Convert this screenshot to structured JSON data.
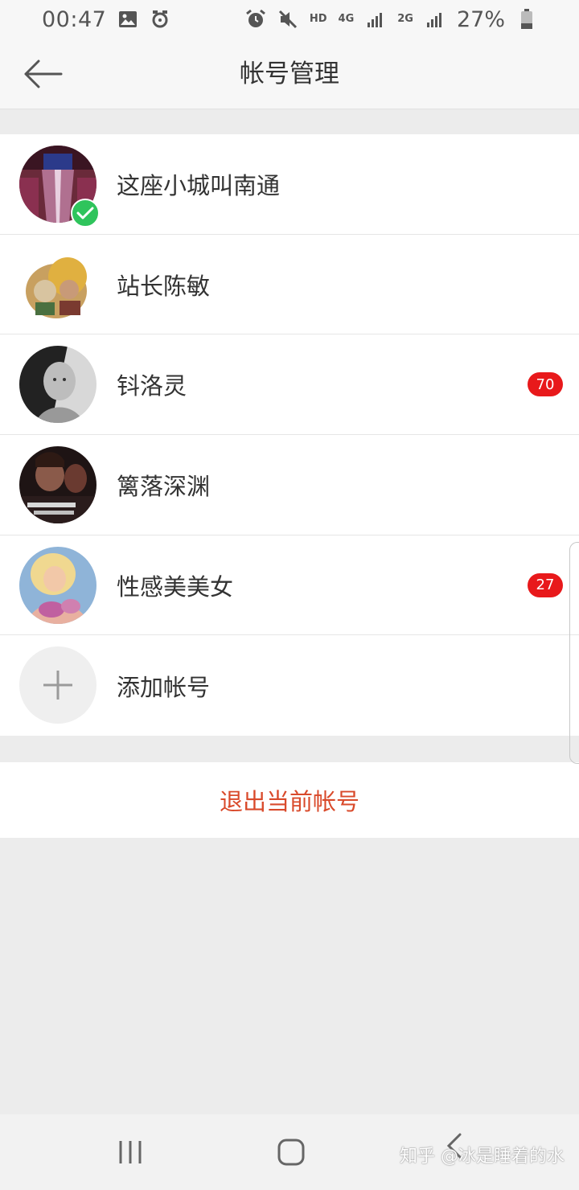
{
  "status_bar": {
    "time": "00:47",
    "net_label_top": "4G",
    "net_label_hd": "HD",
    "net_label_2g": "2G",
    "battery_percent": "27%",
    "icons": [
      "image-icon",
      "notification-icon",
      "alarm-icon",
      "mute-icon",
      "signal-icon",
      "battery-icon"
    ]
  },
  "app_bar": {
    "title": "帐号管理",
    "back_icon": "arrow-left-icon"
  },
  "accounts": [
    {
      "name": "这座小城叫南通",
      "current": true,
      "badge": ""
    },
    {
      "name": "站长陈敏",
      "current": false,
      "badge": ""
    },
    {
      "name": "钭洛灵",
      "current": false,
      "badge": "70"
    },
    {
      "name": "篱落深渊",
      "current": false,
      "badge": ""
    },
    {
      "name": "性感美美女",
      "current": false,
      "badge": "27"
    }
  ],
  "add_account": {
    "label": "添加帐号",
    "icon": "plus-icon"
  },
  "logout": {
    "label": "退出当前帐号"
  },
  "nav_bar": {
    "icons": [
      "recents-icon",
      "home-icon",
      "back-icon"
    ]
  },
  "watermark": "知乎 @冰是睡着的水",
  "colors": {
    "accent_red": "#d94a2b",
    "badge_red": "#e8191b",
    "check_green": "#2fc45c",
    "background": "#ececec"
  }
}
